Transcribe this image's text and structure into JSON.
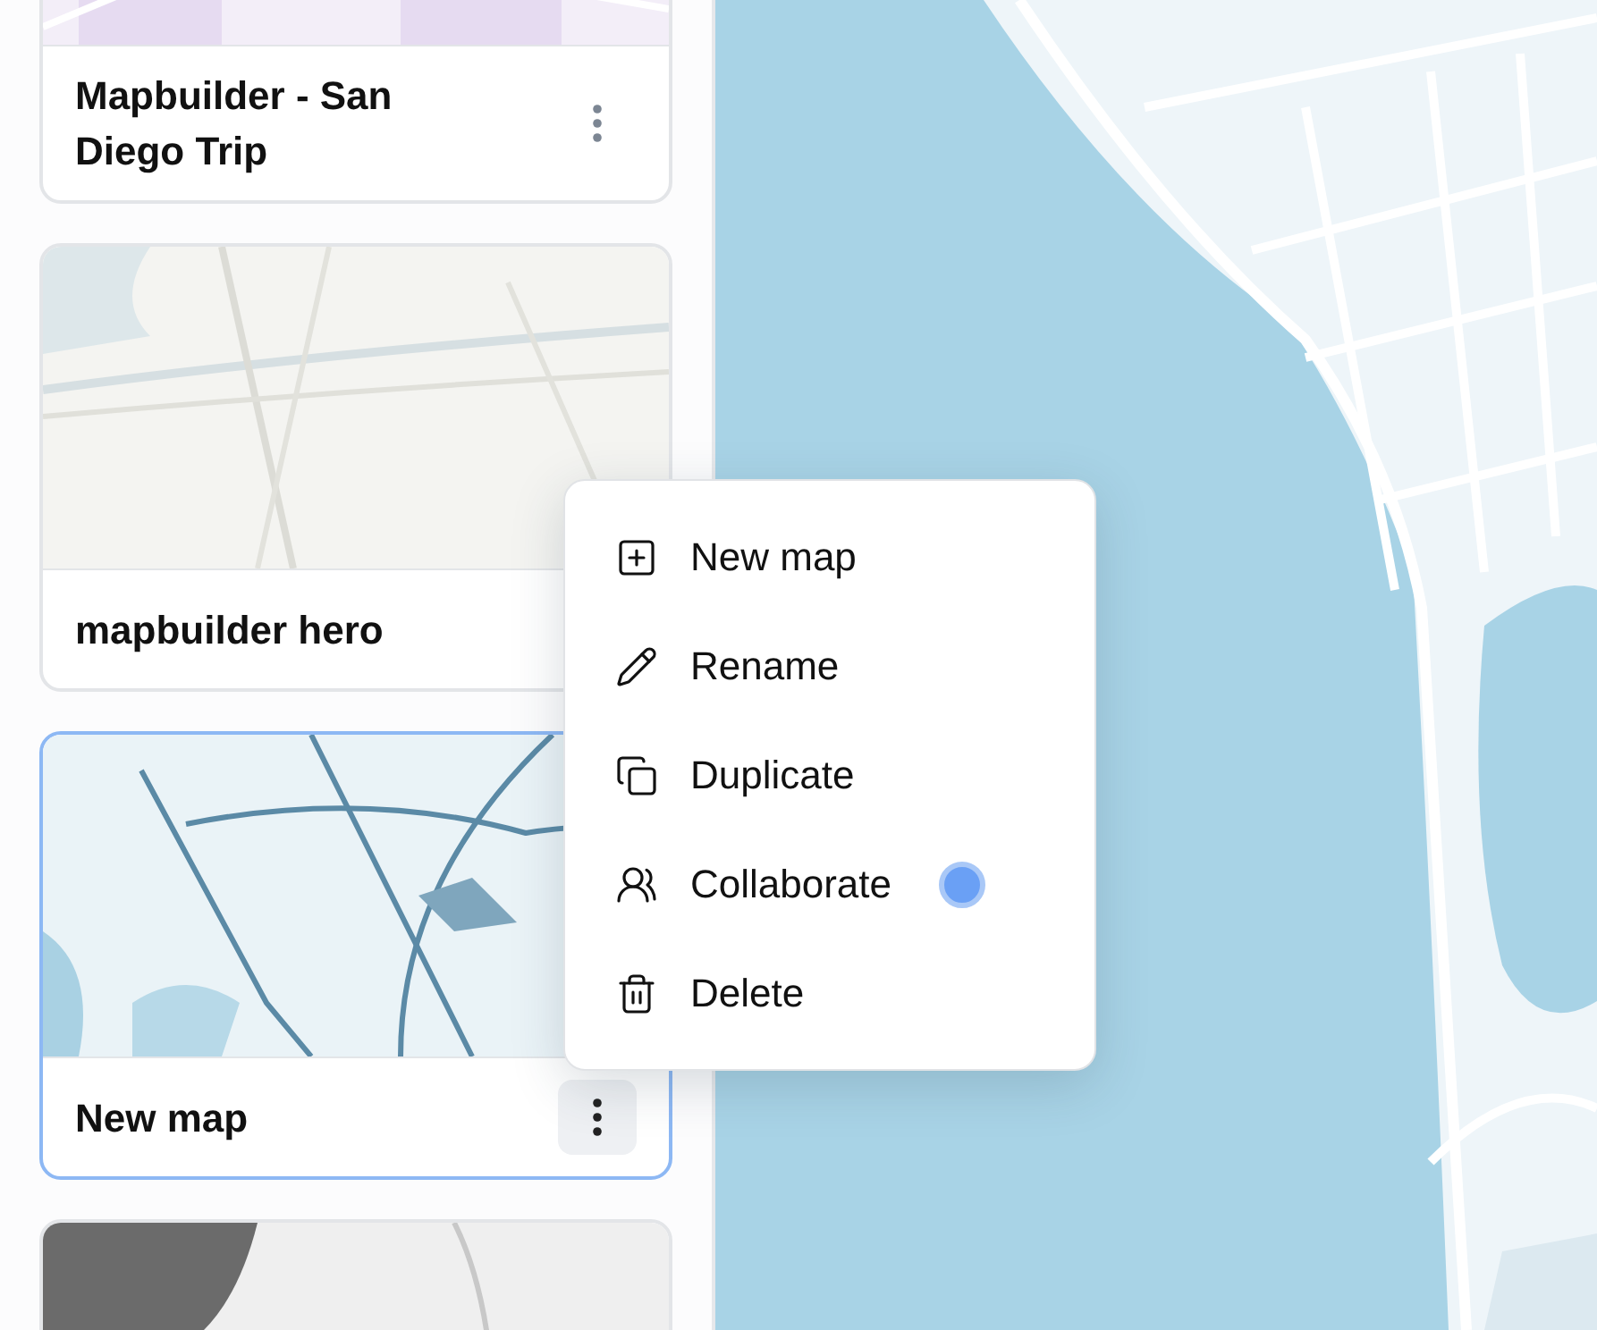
{
  "cards": [
    {
      "name": "Mapbuilder - San Diego Trip",
      "selected": false,
      "menu_open": false
    },
    {
      "name": "mapbuilder hero",
      "selected": false
    },
    {
      "name": "New map",
      "selected": true,
      "menu_open": true
    },
    {
      "selected": false
    }
  ],
  "context_menu": {
    "items": [
      {
        "kind": "new",
        "label": "New map",
        "dot": false
      },
      {
        "kind": "rename",
        "label": "Rename",
        "dot": false
      },
      {
        "kind": "duplicate",
        "label": "Duplicate",
        "dot": false
      },
      {
        "kind": "collaborate",
        "label": "Collaborate",
        "dot": true
      },
      {
        "kind": "delete",
        "label": "Delete",
        "dot": false
      }
    ]
  }
}
